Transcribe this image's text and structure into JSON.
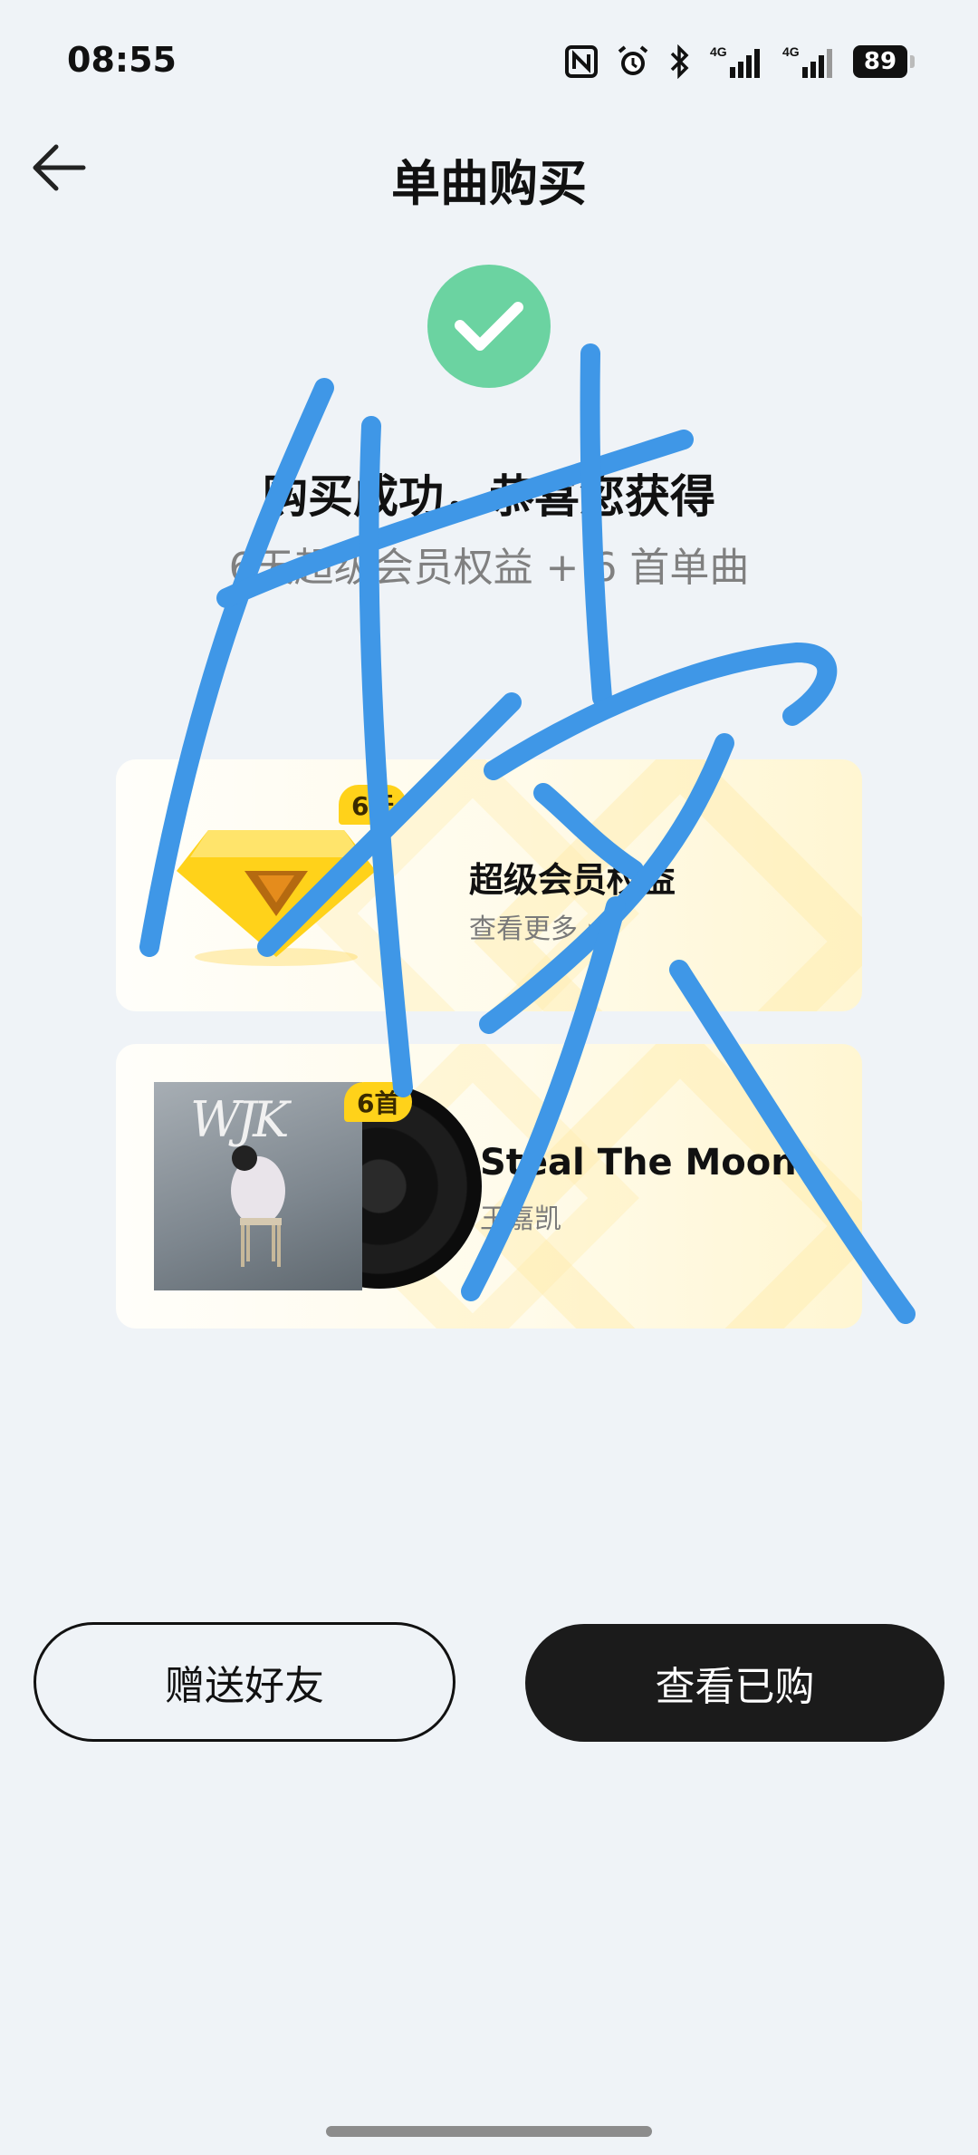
{
  "status_bar": {
    "time": "08:55",
    "battery": "89"
  },
  "header": {
    "title": "单曲购买"
  },
  "success": {
    "title": "购买成功，恭喜您获得",
    "subtitle": "6天超级会员权益 + 6 首单曲"
  },
  "cards": [
    {
      "badge": "6天",
      "title": "超级会员权益",
      "subtitle": "查看更多 ›"
    },
    {
      "badge": "6首",
      "title": "Steal The Moon",
      "subtitle": "王嘉凯",
      "album_text": "WJK"
    }
  ],
  "buttons": {
    "gift": "赠送好友",
    "view": "查看已购"
  },
  "colors": {
    "success_green": "#6bd3a1",
    "badge_yellow": "#ffd21a",
    "scribble_blue": "#3f97e7",
    "dark_button": "#1b1b1b"
  }
}
